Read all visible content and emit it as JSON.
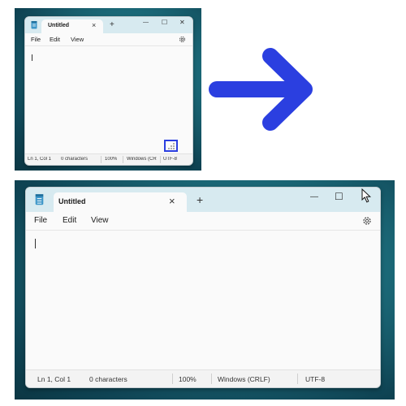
{
  "app": {
    "title": "Untitled",
    "new_tab_glyph": "+",
    "tab_close_glyph": "×"
  },
  "window_controls": {
    "minimize": "—",
    "maximize": "☐",
    "close": "✕"
  },
  "menu": {
    "file": "File",
    "edit": "Edit",
    "view": "View"
  },
  "icons": {
    "settings": "gear-icon",
    "app": "notepad-icon",
    "step_arrow": "arrow-right-icon",
    "pointer": "mouse-cursor-icon"
  },
  "status_small": {
    "position": "Ln 1, Col 1",
    "chars": "0 characters",
    "zoom": "100%",
    "line_ending": "Windows (CR",
    "encoding": "UTF-8"
  },
  "status_large": {
    "position": "Ln 1, Col 1",
    "chars": "0 characters",
    "zoom": "100%",
    "line_ending": "Windows (CRLF)",
    "encoding": "UTF-8"
  },
  "colors": {
    "arrow": "#2b3fe0",
    "highlight": "#2b3fe0",
    "tabbar": "#d7eaf0",
    "desktop": "#1b6877"
  }
}
